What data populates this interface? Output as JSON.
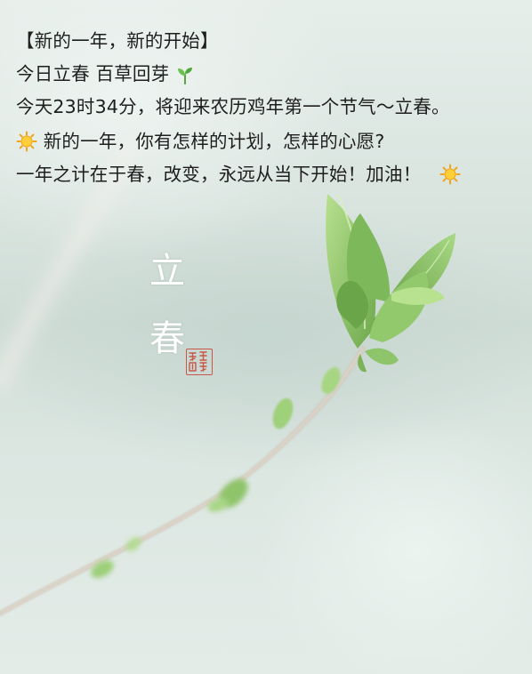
{
  "caption": {
    "line1": "【新的一年，新的开始】",
    "line2": "今日立春 百草回芽",
    "line3": "今天23时34分，将迎来农历鸡年第一个节气～立春。",
    "line4": "新的一年，你有怎样的计划，怎样的心愿?",
    "line5": "一年之计在于春，改变，永远从当下开始！加油！",
    "icons": [
      "seedling-icon",
      "sun-icon",
      "sun-icon"
    ]
  },
  "artwork": {
    "title_char_1": "立",
    "title_char_2": "春",
    "seal_text": "春立"
  },
  "colors": {
    "background": "#dbe6e1",
    "leaf_green": "#8fc46a",
    "branch": "#c9bcae",
    "seal_red": "#c8412f",
    "sun": "#f6b11c"
  }
}
